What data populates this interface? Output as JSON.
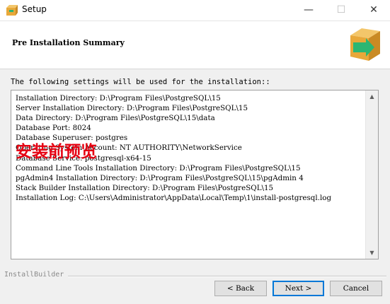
{
  "window": {
    "title": "Setup",
    "controls": {
      "minimize": "—",
      "maximize": "☐",
      "close": "✕"
    }
  },
  "header": {
    "page_title": "Pre Installation Summary"
  },
  "body": {
    "intro": "The following settings will be used for the installation::",
    "summary": "Installation Directory: D:\\Program Files\\PostgreSQL\\15\nServer Installation Directory: D:\\Program Files\\PostgreSQL\\15\nData Directory: D:\\Program Files\\PostgreSQL\\15\\data\nDatabase Port: 8024\nDatabase Superuser: postgres\nOperating System Account: NT AUTHORITY\\NetworkService\nDatabase Service: postgresql-x64-15\nCommand Line Tools Installation Directory: D:\\Program Files\\PostgreSQL\\15\npgAdmin4 Installation Directory: D:\\Program Files\\PostgreSQL\\15\\pgAdmin 4\nStack Builder Installation Directory: D:\\Program Files\\PostgreSQL\\15\nInstallation Log: C:\\Users\\Administrator\\AppData\\Local\\Temp\\1\\install-postgresql.log",
    "annotation": "安装前预览",
    "scroll_up": "▲",
    "scroll_down": "▼"
  },
  "footer": {
    "builder_label": "InstallBuilder",
    "back_label": "< Back",
    "next_label": "Next >",
    "cancel_label": "Cancel"
  },
  "colors": {
    "annotation": "#e60012",
    "box_orange": "#e8a83a",
    "arrow_green": "#2bb673",
    "focus_blue": "#0078d7"
  },
  "icons": [
    "setup-app-icon",
    "install-box-icon",
    "scroll-up-icon",
    "scroll-down-icon"
  ]
}
